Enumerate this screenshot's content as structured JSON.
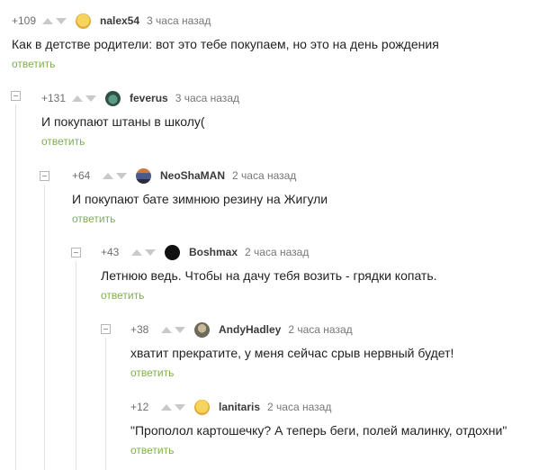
{
  "comments": [
    {
      "rating": "+109",
      "author": "nalex54",
      "time": "3 часа назад",
      "text": "Как в детстве родители: вот это тебе покупаем, но это на день рождения",
      "reply": "ответить",
      "avatar_color": "#f2c94c"
    },
    {
      "rating": "+131",
      "author": "feverus",
      "time": "3 часа назад",
      "text": "И покупают штаны в школу(",
      "reply": "ответить",
      "avatar_color": "#3d6b5c"
    },
    {
      "rating": "+64",
      "author": "NeoShaMAN",
      "time": "2 часа назад",
      "text": "И покупают бате зимнюю резину на Жигули",
      "reply": "ответить",
      "avatar_color": "#4a5a8a"
    },
    {
      "rating": "+43",
      "author": "Boshmax",
      "time": "2 часа назад",
      "text": "Летнюю ведь. Чтобы на дачу тебя возить - грядки копать.",
      "reply": "ответить",
      "avatar_color": "#111111"
    },
    {
      "rating": "+38",
      "author": "AndyHadley",
      "time": "2 часа назад",
      "text": "хватит прекратите, у меня сейчас срыв нервный будет!",
      "reply": "ответить",
      "avatar_color": "#8a8a7a"
    },
    {
      "rating": "+12",
      "author": "lanitaris",
      "time": "2 часа назад",
      "text": "\"Прополол картошечку? А теперь беги, полей малинку, отдохни\"",
      "reply": "ответить",
      "avatar_color": "#f2c94c"
    }
  ]
}
